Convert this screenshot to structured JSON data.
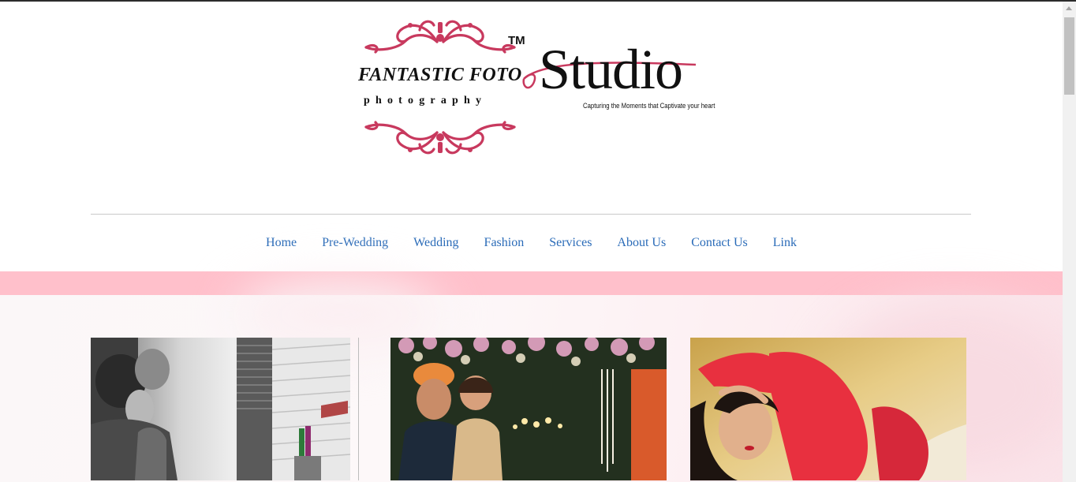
{
  "logo": {
    "wordmark": "FANTASTIC FOTO",
    "sub": "photography",
    "tm": "TM",
    "studio": "Studio",
    "tagline": "Capturing the Moments that Captivate your heart",
    "ornament_color": "#c8395e"
  },
  "nav": {
    "items": [
      {
        "label": "Home"
      },
      {
        "label": "Pre-Wedding"
      },
      {
        "label": "Wedding"
      },
      {
        "label": "Fashion"
      },
      {
        "label": "Services"
      },
      {
        "label": "About Us"
      },
      {
        "label": "Contact Us"
      },
      {
        "label": "Link"
      }
    ],
    "link_color": "#2a6bb8"
  },
  "band_color": "#ffc0cb"
}
